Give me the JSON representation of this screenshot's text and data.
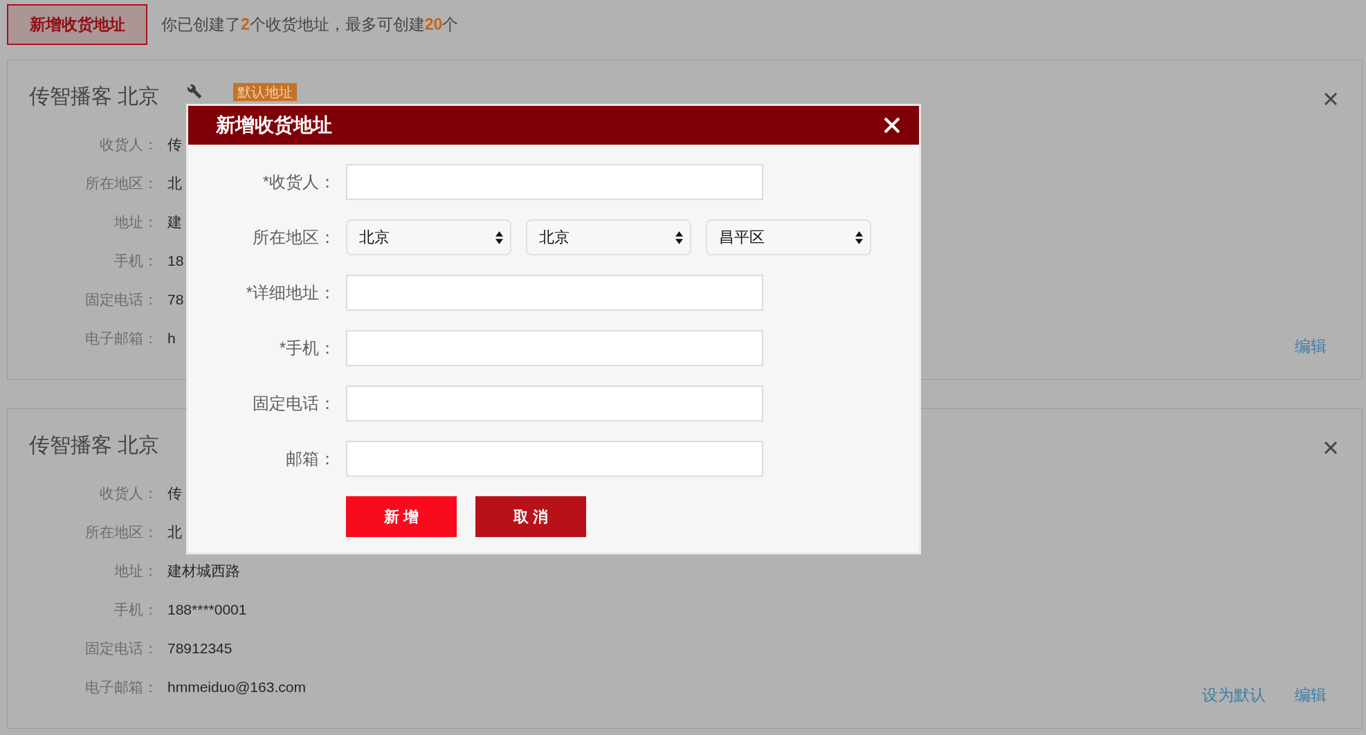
{
  "toolbar": {
    "add_button": "新增收货地址",
    "summary": [
      {
        "text": "你已创建了",
        "kind": "plain"
      },
      {
        "text": "2",
        "kind": "number"
      },
      {
        "text": "个收货地址，最多可创建",
        "kind": "plain"
      },
      {
        "text": "20",
        "kind": "number"
      },
      {
        "text": "个",
        "kind": "plain"
      }
    ]
  },
  "addresses": [
    {
      "title": "传智播客 北京",
      "badge": "默认地址",
      "fields": [
        {
          "label": "收货人：",
          "value": "传"
        },
        {
          "label": "所在地区：",
          "value": "北"
        },
        {
          "label": "地址：",
          "value": "建"
        },
        {
          "label": "手机：",
          "value": "18"
        },
        {
          "label": "固定电话：",
          "value": "78"
        },
        {
          "label": "电子邮箱：",
          "value": "h"
        }
      ],
      "actions": [
        "编辑"
      ]
    },
    {
      "title": "传智播客 北京",
      "fields": [
        {
          "label": "收货人：",
          "value": "传"
        },
        {
          "label": "所在地区：",
          "value": "北"
        },
        {
          "label": "地址：",
          "value": "建材城西路"
        },
        {
          "label": "手机：",
          "value": "188****0001"
        },
        {
          "label": "固定电话：",
          "value": "78912345"
        },
        {
          "label": "电子邮箱：",
          "value": "hmmeiduo@163.com"
        }
      ],
      "actions": [
        "设为默认",
        "编辑"
      ]
    }
  ],
  "dialog": {
    "title": "新增收货地址",
    "fields": [
      {
        "kind": "text",
        "label": "*收货人："
      },
      {
        "kind": "select",
        "label": "所在地区：",
        "selects": [
          {
            "value": "北京"
          },
          {
            "value": "北京"
          },
          {
            "value": "昌平区"
          }
        ]
      },
      {
        "kind": "text",
        "label": "*详细地址："
      },
      {
        "kind": "text",
        "label": "*手机："
      },
      {
        "kind": "text",
        "label": "固定电话："
      },
      {
        "kind": "text",
        "label": "邮箱："
      }
    ],
    "buttons": [
      {
        "label": "新 增",
        "kind": "primary"
      },
      {
        "label": "取 消",
        "kind": "secondary"
      }
    ]
  }
}
